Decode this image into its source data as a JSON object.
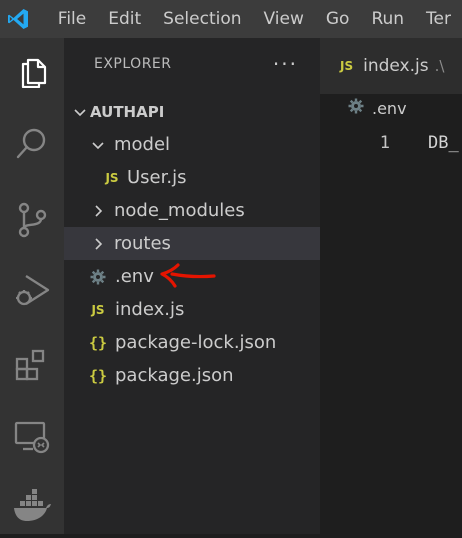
{
  "menu": {
    "items": [
      "File",
      "Edit",
      "Selection",
      "View",
      "Go",
      "Run",
      "Ter"
    ]
  },
  "activity_bar": {
    "items": [
      "explorer-icon",
      "search-icon",
      "source-control-icon",
      "run-debug-icon",
      "extensions-icon",
      "remote-explorer-icon",
      "docker-icon"
    ]
  },
  "explorer": {
    "title": "EXPLORER",
    "more": "···",
    "root": "AUTHAPI",
    "tree": [
      {
        "label": "model",
        "type": "folder",
        "expanded": true,
        "level": 1
      },
      {
        "label": "User.js",
        "type": "js",
        "level": 2,
        "icon_text": "JS"
      },
      {
        "label": "node_modules",
        "type": "folder",
        "expanded": false,
        "level": 1
      },
      {
        "label": "routes",
        "type": "folder",
        "expanded": false,
        "level": 1,
        "selected": true
      },
      {
        "label": ".env",
        "type": "env",
        "level": 1
      },
      {
        "label": "index.js",
        "type": "js",
        "level": 1,
        "icon_text": "JS"
      },
      {
        "label": "package-lock.json",
        "type": "json",
        "level": 1,
        "icon_text": "{}"
      },
      {
        "label": "package.json",
        "type": "json",
        "level": 1,
        "icon_text": "{}"
      }
    ]
  },
  "editor": {
    "tab": {
      "icon_text": "JS",
      "label": "index.js",
      "path": ".\\"
    },
    "breadcrumb": ".env",
    "lines": [
      {
        "number": "1",
        "text": "DB_"
      }
    ]
  },
  "colors": {
    "accent_js": "#cbcb41",
    "annotation": "#e51400",
    "logo": "#23a9f2"
  }
}
